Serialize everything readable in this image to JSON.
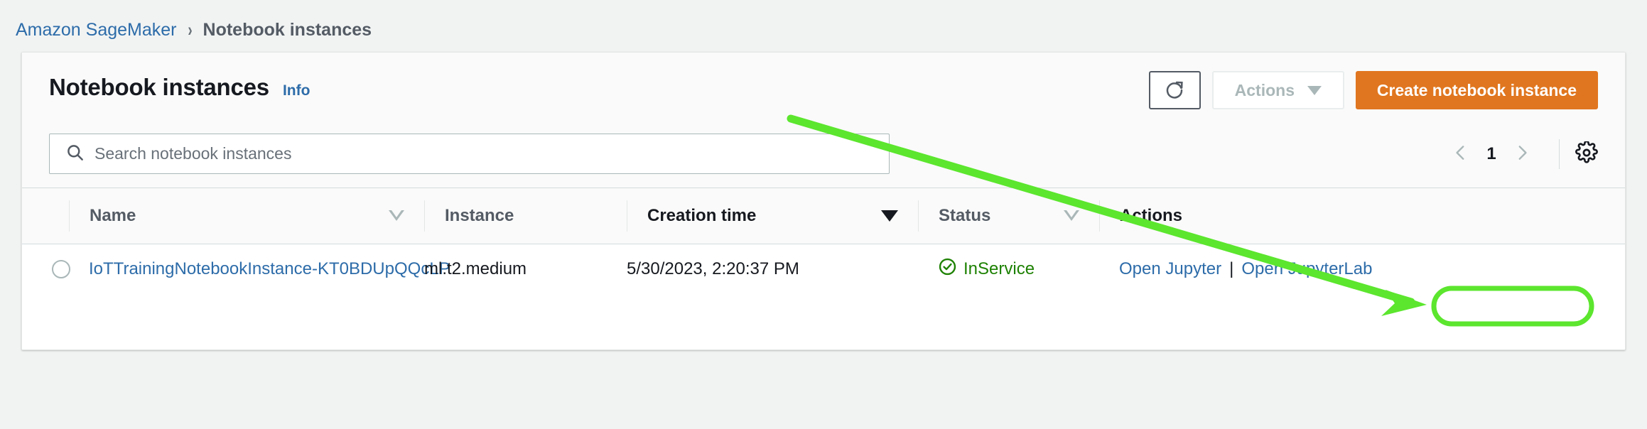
{
  "breadcrumb": {
    "root": "Amazon SageMaker",
    "separator": "›",
    "current": "Notebook instances"
  },
  "header": {
    "title": "Notebook instances",
    "info_label": "Info",
    "refresh_icon": "refresh-icon",
    "actions_label": "Actions",
    "create_label": "Create notebook instance"
  },
  "search": {
    "icon": "search-icon",
    "placeholder": "Search notebook instances",
    "value": ""
  },
  "pagination": {
    "prev_icon": "chevron-left-icon",
    "page": "1",
    "next_icon": "chevron-right-icon",
    "settings_icon": "gear-icon"
  },
  "table": {
    "columns": [
      {
        "label": "Name",
        "sort": "hollow"
      },
      {
        "label": "Instance",
        "sort": "none"
      },
      {
        "label": "Creation time",
        "sort": "solid"
      },
      {
        "label": "Status",
        "sort": "hollow"
      },
      {
        "label": "Actions",
        "sort": "none"
      }
    ],
    "rows": [
      {
        "name": "IoTTrainingNotebookInstance-KT0BDUpQQcLP",
        "instance": "ml.t2.medium",
        "creation_time": "5/30/2023, 2:20:37 PM",
        "status": "InService",
        "status_icon": "check-circle-icon",
        "actions": {
          "open_jupyter": "Open Jupyter",
          "separator": "|",
          "open_jupyterlab": "Open JupyterLab"
        }
      }
    ]
  },
  "annotation": {
    "highlight_target": "Open JupyterLab",
    "color": "#5CE62E",
    "arrow": "diagonal-arrow"
  },
  "colors": {
    "accent_orange": "#e0761f",
    "link_blue": "#2d6ca9",
    "status_green": "#1d8102",
    "annotation_green": "#5CE62E",
    "page_bg": "#f1f3f3"
  }
}
